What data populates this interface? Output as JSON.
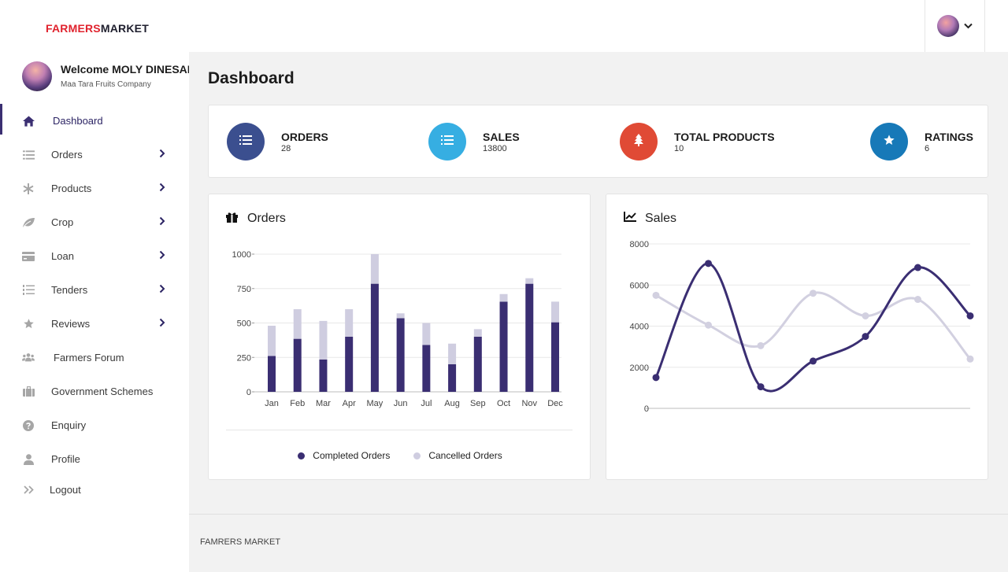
{
  "brand": {
    "part1": "FARMERS",
    "part2": "MARKET"
  },
  "user": {
    "welcome": "Welcome MOLY DINESAN",
    "company": "Maa Tara Fruits Company",
    "menu_icon": "chevron-down-icon"
  },
  "sidebar": {
    "items": [
      {
        "label": "Dashboard",
        "icon": "home-icon",
        "active": true,
        "has_arrow": false
      },
      {
        "label": "Orders",
        "icon": "list-icon",
        "active": false,
        "has_arrow": true
      },
      {
        "label": "Products",
        "icon": "asterisk-icon",
        "active": false,
        "has_arrow": true
      },
      {
        "label": "Crop",
        "icon": "leaf-icon",
        "active": false,
        "has_arrow": true
      },
      {
        "label": "Loan",
        "icon": "credit-card-icon",
        "active": false,
        "has_arrow": true
      },
      {
        "label": "Tenders",
        "icon": "list-ol-icon",
        "active": false,
        "has_arrow": true
      },
      {
        "label": "Reviews",
        "icon": "star-icon",
        "active": false,
        "has_arrow": true
      },
      {
        "label": "Farmers Forum",
        "icon": "users-icon",
        "active": false,
        "has_arrow": false
      },
      {
        "label": "Government Schemes",
        "icon": "briefcase-icon",
        "active": false,
        "has_arrow": false
      },
      {
        "label": "Enquiry",
        "icon": "question-circle-icon",
        "active": false,
        "has_arrow": false
      },
      {
        "label": "Profile",
        "icon": "user-icon",
        "active": false,
        "has_arrow": false
      },
      {
        "label": "Logout",
        "icon": "double-chevron-right-icon",
        "active": false,
        "has_arrow": false
      }
    ]
  },
  "main": {
    "title": "Dashboard",
    "stats": [
      {
        "title": "ORDERS",
        "value": "28",
        "color": "#3b4f8f",
        "icon": "list-icon"
      },
      {
        "title": "SALES",
        "value": "13800",
        "color": "#36aee2",
        "icon": "list-icon"
      },
      {
        "title": "TOTAL PRODUCTS",
        "value": "10",
        "color": "#e04a35",
        "icon": "tree-icon"
      },
      {
        "title": "RATINGS",
        "value": "6",
        "color": "#1779b8",
        "icon": "star-icon"
      }
    ],
    "orders_panel": {
      "title": "Orders",
      "icon": "gift-icon"
    },
    "sales_panel": {
      "title": "Sales",
      "icon": "line-chart-icon"
    }
  },
  "chart_data": [
    {
      "type": "bar",
      "stacked": true,
      "categories": [
        "Jan",
        "Feb",
        "Mar",
        "Apr",
        "May",
        "Jun",
        "Jul",
        "Aug",
        "Sep",
        "Oct",
        "Nov",
        "Dec"
      ],
      "series": [
        {
          "name": "Completed Orders",
          "color": "#3a2e72",
          "values": [
            260,
            385,
            235,
            400,
            785,
            535,
            340,
            200,
            400,
            655,
            785,
            505
          ]
        },
        {
          "name": "Cancelled Orders",
          "color": "#cfcde0",
          "values": [
            220,
            215,
            280,
            200,
            215,
            35,
            160,
            150,
            55,
            55,
            40,
            150
          ]
        }
      ],
      "ylim": [
        0,
        1000
      ],
      "yticks": [
        0,
        250,
        500,
        750,
        1000
      ],
      "grid": true,
      "legend": "bottom"
    },
    {
      "type": "line",
      "smooth": true,
      "x_points": 7,
      "series": [
        {
          "name": "",
          "color": "#3a2e72",
          "values": [
            1500,
            7050,
            1050,
            2300,
            3500,
            6850,
            4500
          ]
        },
        {
          "name": "",
          "color": "#d2d0e0",
          "values": [
            5500,
            4050,
            3050,
            5600,
            4500,
            5300,
            2400
          ]
        }
      ],
      "ylim": [
        0,
        8000
      ],
      "yticks": [
        0,
        2000,
        4000,
        6000,
        8000
      ],
      "grid": true,
      "legend": "none"
    }
  ],
  "footer": {
    "text": "FAMRERS MARKET"
  }
}
